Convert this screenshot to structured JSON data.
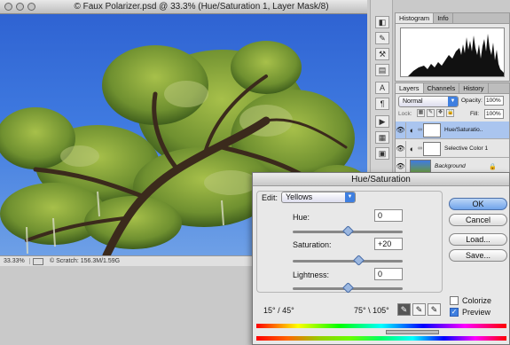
{
  "document": {
    "title": "© Faux Polarizer.psd @ 33.3% (Hue/Saturation 1, Layer Mask/8)",
    "zoom": "33.33%",
    "scratch": "© Scratch: 156.3M/1.59G"
  },
  "histogram_panel": {
    "tabs": [
      "Histogram",
      "Info"
    ]
  },
  "layers_panel": {
    "tabs": [
      "Layers",
      "Channels",
      "History"
    ],
    "blend_mode": "Normal",
    "opacity_label": "Opacity:",
    "opacity_value": "100%",
    "lock_label": "Lock:",
    "fill_label": "Fill:",
    "fill_value": "100%",
    "layers": [
      {
        "name": "Hue/Saturatio..",
        "selected": true
      },
      {
        "name": "Selective Color 1",
        "selected": false
      },
      {
        "name": "Background",
        "selected": false
      }
    ]
  },
  "hue_saturation": {
    "title": "Hue/Saturation",
    "edit_label": "Edit:",
    "edit_value": "Yellows",
    "hue_label": "Hue:",
    "hue_value": "0",
    "saturation_label": "Saturation:",
    "saturation_value": "+20",
    "lightness_label": "Lightness:",
    "lightness_value": "0",
    "range_left": "15° / 45°",
    "range_right": "75° \\ 105°",
    "buttons": {
      "ok": "OK",
      "cancel": "Cancel",
      "load": "Load...",
      "save": "Save..."
    },
    "colorize_label": "Colorize",
    "colorize_checked": false,
    "preview_label": "Preview",
    "preview_checked": true
  }
}
